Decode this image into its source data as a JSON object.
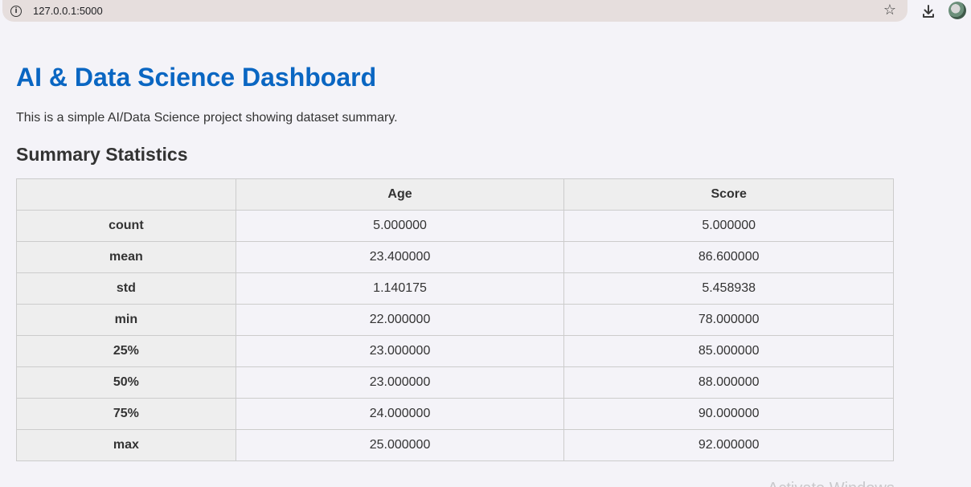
{
  "browser": {
    "url": "127.0.0.1:5000"
  },
  "page": {
    "title": "AI & Data Science Dashboard",
    "description": "This is a simple AI/Data Science project showing dataset summary.",
    "section_heading": "Summary Statistics"
  },
  "table": {
    "columns": [
      "",
      "Age",
      "Score"
    ],
    "rows": [
      {
        "label": "count",
        "age": "5.000000",
        "score": "5.000000"
      },
      {
        "label": "mean",
        "age": "23.400000",
        "score": "86.600000"
      },
      {
        "label": "std",
        "age": "1.140175",
        "score": "5.458938"
      },
      {
        "label": "min",
        "age": "22.000000",
        "score": "78.000000"
      },
      {
        "label": "25%",
        "age": "23.000000",
        "score": "85.000000"
      },
      {
        "label": "50%",
        "age": "23.000000",
        "score": "88.000000"
      },
      {
        "label": "75%",
        "age": "24.000000",
        "score": "90.000000"
      },
      {
        "label": "max",
        "age": "25.000000",
        "score": "92.000000"
      }
    ]
  },
  "watermark": "Activate Windows",
  "colors": {
    "title": "#0a66c2",
    "background": "#f4f3f8",
    "header_bg": "#eeeeee",
    "border": "#cccccc"
  },
  "icons": [
    "info-icon",
    "star-icon",
    "download-icon",
    "avatar"
  ]
}
